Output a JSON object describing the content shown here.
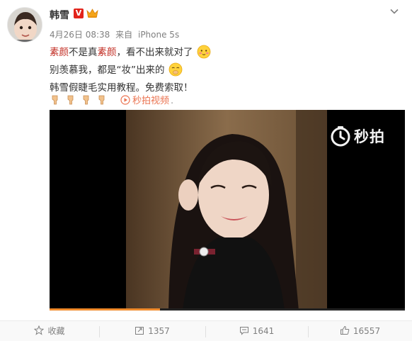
{
  "post": {
    "author": "韩雪",
    "date": "4月26日 08:38",
    "source_prefix": "来自",
    "source": "iPhone 5s",
    "line1": {
      "hl1": "素颜",
      "mid": "不是真",
      "hl2": "素颜",
      "rest": "，看不出来就对了"
    },
    "line2": "别羡慕我，都是“妆”出来的",
    "line3": "韩雪假睫毛实用教程。免费索取！",
    "video_label": "秒拍视频",
    "video_dot": ".",
    "watermark": "秒拍",
    "video_progress": 0.31
  },
  "footer": {
    "favorite_label": "收藏",
    "repost_count": "1357",
    "comment_count": "1641",
    "like_count": "16557"
  },
  "colors": {
    "highlight": "#c0281e",
    "link": "#eb7350",
    "verified": "#e2231a",
    "progress": "#f08b2c"
  }
}
